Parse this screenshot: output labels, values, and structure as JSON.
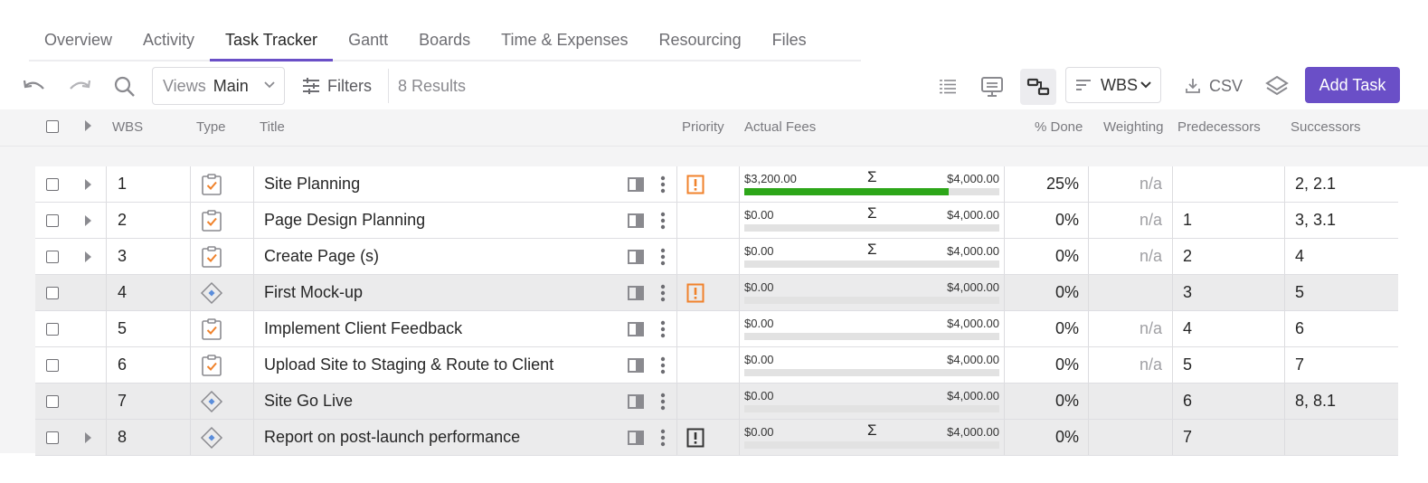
{
  "tabs": [
    {
      "label": "Overview",
      "active": false
    },
    {
      "label": "Activity",
      "active": false
    },
    {
      "label": "Task Tracker",
      "active": true
    },
    {
      "label": "Gantt",
      "active": false
    },
    {
      "label": "Boards",
      "active": false
    },
    {
      "label": "Time & Expenses",
      "active": false
    },
    {
      "label": "Resourcing",
      "active": false
    },
    {
      "label": "Files",
      "active": false
    }
  ],
  "toolbar": {
    "views_label": "Views",
    "views_value": "Main",
    "filters_label": "Filters",
    "results": "8 Results",
    "sort_value": "WBS",
    "csv_label": "CSV",
    "add_task_label": "Add Task",
    "accent_color": "#6a4fc7"
  },
  "columns": {
    "wbs": "WBS",
    "type": "Type",
    "title": "Title",
    "priority": "Priority",
    "actual_fees": "Actual Fees",
    "pct_done": "% Done",
    "weighting": "Weighting",
    "predecessors": "Predecessors",
    "successors": "Successors"
  },
  "rows": [
    {
      "wbs": "1",
      "type": "task-icon",
      "title": "Site Planning",
      "expandable": true,
      "priority": "high",
      "fee_actual": "$3,200.00",
      "fee_total": "$4,000.00",
      "sigma": true,
      "progress": 0.8,
      "done": "25%",
      "weighting": "n/a",
      "pred": "",
      "succ": "2, 2.1"
    },
    {
      "wbs": "2",
      "type": "task-icon",
      "title": "Page Design Planning",
      "expandable": true,
      "priority": "",
      "fee_actual": "$0.00",
      "fee_total": "$4,000.00",
      "sigma": true,
      "progress": 0,
      "done": "0%",
      "weighting": "n/a",
      "pred": "1",
      "succ": "3, 3.1"
    },
    {
      "wbs": "3",
      "type": "task-icon",
      "title": "Create Page (s)",
      "expandable": true,
      "priority": "",
      "fee_actual": "$0.00",
      "fee_total": "$4,000.00",
      "sigma": true,
      "progress": 0,
      "done": "0%",
      "weighting": "n/a",
      "pred": "2",
      "succ": "4"
    },
    {
      "wbs": "4",
      "type": "milestone-icon",
      "title": "First Mock-up",
      "expandable": false,
      "priority": "high",
      "fee_actual": "$0.00",
      "fee_total": "$4,000.00",
      "sigma": false,
      "progress": 0,
      "done": "0%",
      "weighting": "",
      "pred": "3",
      "succ": "5"
    },
    {
      "wbs": "5",
      "type": "task-icon",
      "title": "Implement Client Feedback",
      "expandable": false,
      "priority": "",
      "fee_actual": "$0.00",
      "fee_total": "$4,000.00",
      "sigma": false,
      "progress": 0,
      "done": "0%",
      "weighting": "n/a",
      "pred": "4",
      "succ": "6"
    },
    {
      "wbs": "6",
      "type": "task-icon",
      "title": "Upload Site to Staging & Route to Client",
      "expandable": false,
      "priority": "",
      "fee_actual": "$0.00",
      "fee_total": "$4,000.00",
      "sigma": false,
      "progress": 0,
      "done": "0%",
      "weighting": "n/a",
      "pred": "5",
      "succ": "7"
    },
    {
      "wbs": "7",
      "type": "milestone-icon",
      "title": "Site Go Live",
      "expandable": false,
      "priority": "",
      "fee_actual": "$0.00",
      "fee_total": "$4,000.00",
      "sigma": false,
      "progress": 0,
      "done": "0%",
      "weighting": "",
      "pred": "6",
      "succ": "8, 8.1"
    },
    {
      "wbs": "8",
      "type": "milestone-icon",
      "title": "Report on post-launch performance",
      "expandable": true,
      "priority": "critical",
      "fee_actual": "$0.00",
      "fee_total": "$4,000.00",
      "sigma": true,
      "progress": 0,
      "done": "0%",
      "weighting": "",
      "pred": "7",
      "succ": ""
    }
  ]
}
